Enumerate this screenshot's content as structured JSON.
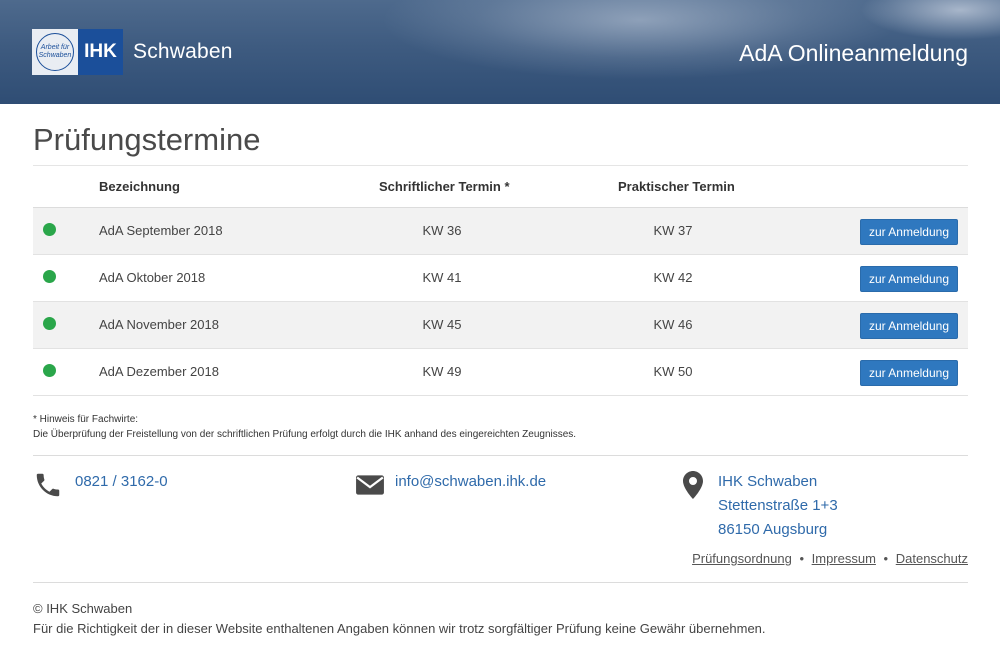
{
  "header": {
    "logo_seal_text": "Arbeit für Schwaben",
    "logo_ihk": "IHK",
    "logo_name": "Schwaben",
    "app_title": "AdA Onlineanmeldung"
  },
  "page": {
    "title": "Prüfungstermine"
  },
  "table": {
    "headers": {
      "name": "Bezeichnung",
      "written": "Schriftlicher Termin *",
      "practical": "Praktischer Termin"
    },
    "rows": [
      {
        "name": "AdA September 2018",
        "written": "KW 36",
        "practical": "KW 37",
        "button": "zur Anmeldung",
        "status_color": "#2aa64a"
      },
      {
        "name": "AdA Oktober 2018",
        "written": "KW 41",
        "practical": "KW 42",
        "button": "zur Anmeldung",
        "status_color": "#2aa64a"
      },
      {
        "name": "AdA November 2018",
        "written": "KW 45",
        "practical": "KW 46",
        "button": "zur Anmeldung",
        "status_color": "#2aa64a"
      },
      {
        "name": "AdA Dezember 2018",
        "written": "KW 49",
        "practical": "KW 50",
        "button": "zur Anmeldung",
        "status_color": "#2aa64a"
      }
    ]
  },
  "note": {
    "line1": "* Hinweis für Fachwirte:",
    "line2": "Die Überprüfung der Freistellung von der schriftlichen Prüfung erfolgt durch die IHK anhand des eingereichten Zeugnisses."
  },
  "contact": {
    "phone": "0821 / 3162-0",
    "email": "info@schwaben.ihk.de",
    "address": [
      "IHK Schwaben",
      "Stettenstraße 1+3",
      "86150 Augsburg"
    ]
  },
  "links": [
    "Prüfungsordnung",
    "Impressum",
    "Datenschutz"
  ],
  "link_separator": "•",
  "footer": {
    "copyright": "© IHK Schwaben",
    "disclaimer": "Für die Richtigkeit der in dieser Website enthaltenen Angaben können wir trotz sorgfältiger Prüfung keine Gewähr übernehmen."
  },
  "colors": {
    "header": "#3e5b80",
    "brand_blue": "#1b4f9a",
    "button": "#2f78bf",
    "link": "#2f6aaa",
    "status_ok": "#2aa64a"
  },
  "icons": [
    "phone-icon",
    "envelope-icon",
    "map-marker-icon"
  ]
}
